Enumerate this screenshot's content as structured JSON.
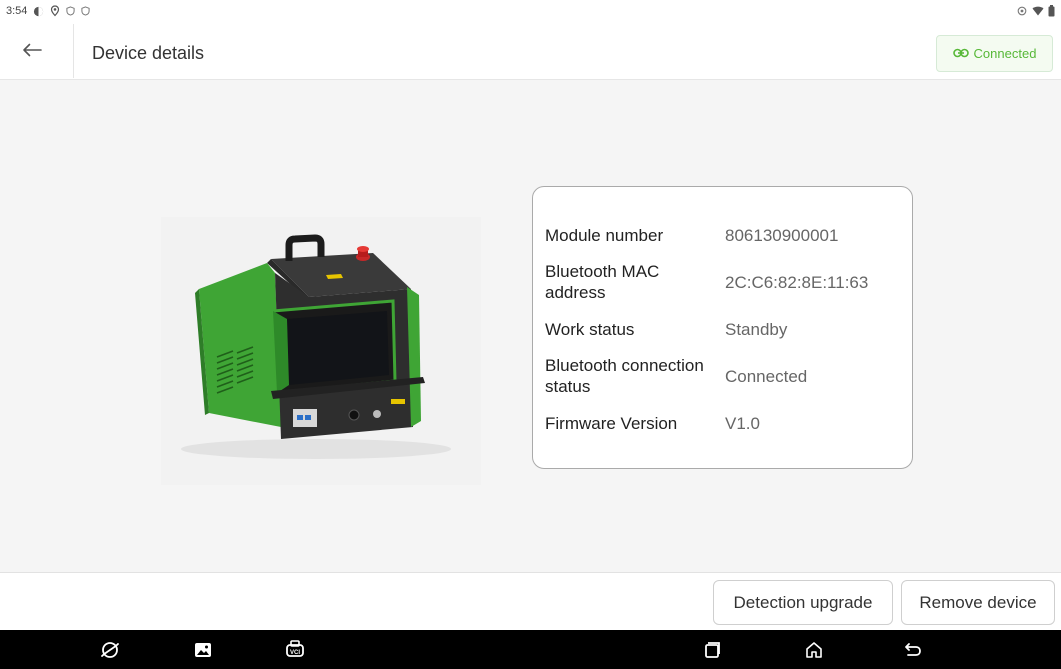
{
  "status_bar": {
    "time": "3:54",
    "left_icons": [
      "data-saver-icon",
      "location-icon",
      "shield-icon",
      "shield-icon"
    ],
    "right_icons": [
      "sync-icon",
      "wifi-icon",
      "battery-icon"
    ]
  },
  "header": {
    "title": "Device details",
    "back_icon": "arrow-left-icon",
    "connection_status": "Connected",
    "connection_icon": "link-icon",
    "accent_color": "#57b838"
  },
  "device_info": {
    "rows": [
      {
        "label": "Module number",
        "value": "806130900001"
      },
      {
        "label": "Bluetooth MAC address",
        "value": "2C:C6:82:8E:11:63"
      },
      {
        "label": "Work status",
        "value": "Standby"
      },
      {
        "label": "Bluetooth connection status",
        "value": "Connected"
      },
      {
        "label": "Firmware Version",
        "value": "V1.0"
      }
    ]
  },
  "device_image": {
    "description_icon": "device-photo",
    "panel_badge": "VCI"
  },
  "footer": {
    "detection_upgrade_label": "Detection upgrade",
    "remove_device_label": "Remove device"
  },
  "nav_bar": {
    "icons": [
      "browser-icon",
      "gallery-icon",
      "vci-icon",
      "recent-apps-icon",
      "home-icon",
      "back-icon"
    ]
  }
}
